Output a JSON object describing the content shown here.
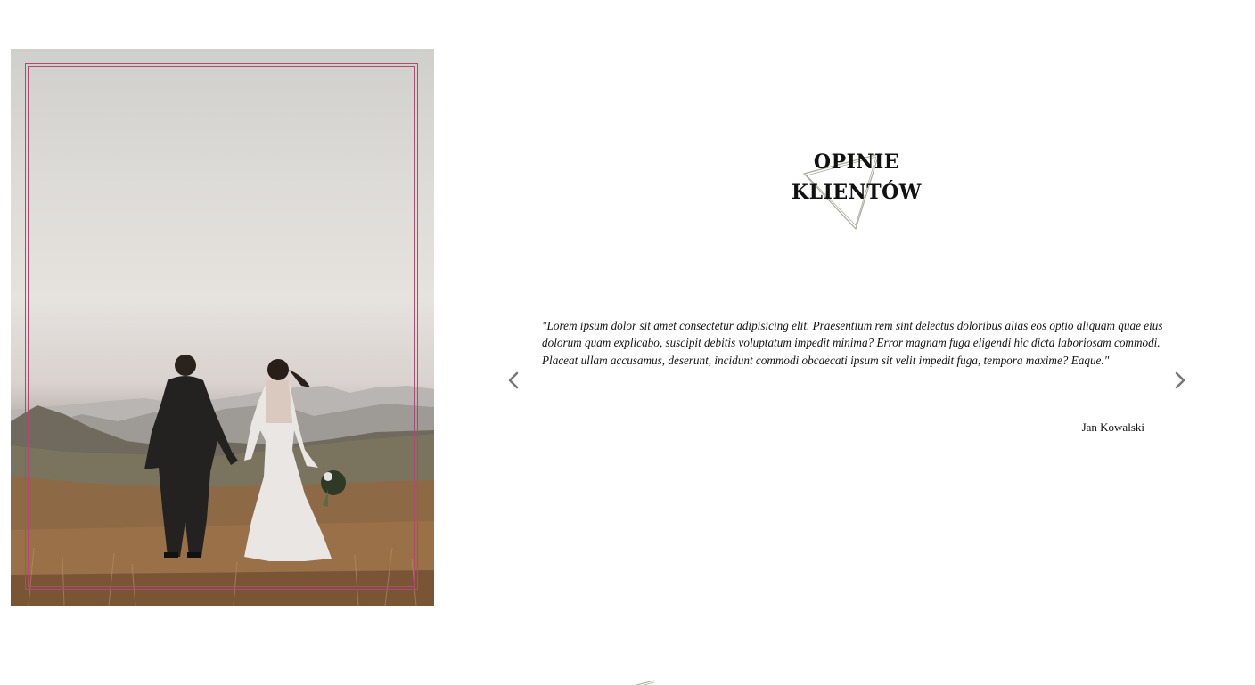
{
  "testimonials": {
    "heading_line1": "OPINIE",
    "heading_line2": "KLIENTÓW",
    "quote": "\"Lorem ipsum dolor sit amet consectetur adipisicing elit. Praesentium rem sint delectus doloribus alias eos optio aliquam quae eius dolorum quam explicabo, suscipit debitis voluptatum impedit minima? Error magnam fuga eligendi hic dicta laboriosam commodi. Placeat ullam accusamus, deserunt, incidunt commodi obcaecati ipsum sit velit impedit fuga, tempora maxime? Eaque.\"",
    "author": "Jan Kowalski",
    "prev_icon": "chevron-left-icon",
    "next_icon": "chevron-right-icon"
  },
  "photo": {
    "subject": "wedding-couple-photo"
  },
  "colors": {
    "frame": "#b04a72",
    "triangle": "#a9ab9a",
    "arrow": "#777777",
    "text": "#111111"
  }
}
